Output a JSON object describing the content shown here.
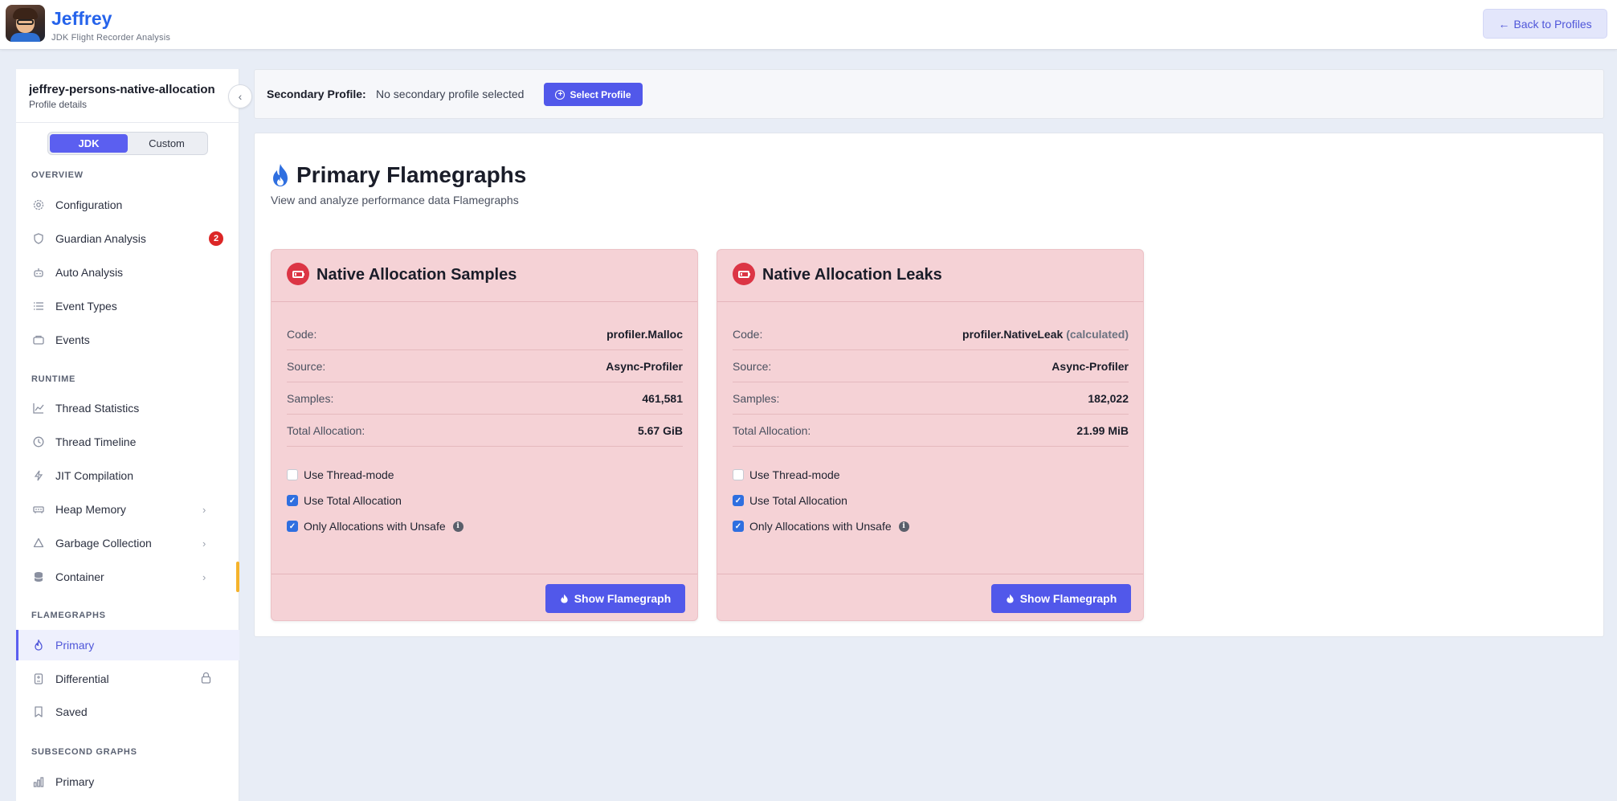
{
  "header": {
    "app_title": "Jeffrey",
    "app_subtitle": "JDK Flight Recorder Analysis",
    "back_label": "Back to Profiles",
    "back_arrow": "←"
  },
  "sidebar": {
    "profile_name": "jeffrey-persons-native-allocation",
    "profile_sub": "Profile details",
    "collapse_glyph": "‹",
    "mode_tabs": [
      "JDK",
      "Custom"
    ],
    "active_mode": "JDK",
    "sections": [
      {
        "title": "OVERVIEW",
        "items": [
          {
            "label": "Configuration",
            "icon": "gear-icon"
          },
          {
            "label": "Guardian Analysis",
            "icon": "shield-icon",
            "badge": "2"
          },
          {
            "label": "Auto Analysis",
            "icon": "robot-icon"
          },
          {
            "label": "Event Types",
            "icon": "list-icon"
          },
          {
            "label": "Events",
            "icon": "folder-icon"
          }
        ]
      },
      {
        "title": "RUNTIME",
        "items": [
          {
            "label": "Thread Statistics",
            "icon": "chart-line-icon"
          },
          {
            "label": "Thread Timeline",
            "icon": "clock-icon"
          },
          {
            "label": "JIT Compilation",
            "icon": "lightning-icon"
          },
          {
            "label": "Heap Memory",
            "icon": "memory-icon",
            "expandable": true
          },
          {
            "label": "Garbage Collection",
            "icon": "recycle-icon",
            "expandable": true
          },
          {
            "label": "Container",
            "icon": "database-icon",
            "expandable": true
          }
        ]
      },
      {
        "title": "FLAMEGRAPHS",
        "items": [
          {
            "label": "Primary",
            "icon": "fire-icon",
            "active": true
          },
          {
            "label": "Differential",
            "icon": "file-diff-icon",
            "locked": true
          },
          {
            "label": "Saved",
            "icon": "bookmark-icon"
          }
        ]
      },
      {
        "title": "SUBSECOND GRAPHS",
        "items": [
          {
            "label": "Primary",
            "icon": "bar-chart-icon"
          }
        ]
      }
    ]
  },
  "secondary": {
    "label": "Secondary Profile:",
    "value": "No secondary profile selected",
    "button_label": "Select Profile"
  },
  "main": {
    "title": "Primary Flamegraphs",
    "subtitle": "View and analyze performance data Flamegraphs",
    "cards": [
      {
        "title": "Native Allocation Samples",
        "rows": [
          {
            "key": "Code:",
            "value": "profiler.Malloc",
            "note": ""
          },
          {
            "key": "Source:",
            "value": "Async-Profiler",
            "note": ""
          },
          {
            "key": "Samples:",
            "value": "461,581",
            "note": ""
          },
          {
            "key": "Total Allocation:",
            "value": "5.67 GiB",
            "note": ""
          }
        ],
        "options": [
          {
            "label": "Use Thread-mode",
            "checked": false
          },
          {
            "label": "Use Total Allocation",
            "checked": true
          },
          {
            "label": "Only Allocations with Unsafe",
            "checked": true,
            "info": "i"
          }
        ],
        "button_label": "Show Flamegraph"
      },
      {
        "title": "Native Allocation Leaks",
        "rows": [
          {
            "key": "Code:",
            "value": "profiler.NativeLeak",
            "note": "(calculated)"
          },
          {
            "key": "Source:",
            "value": "Async-Profiler",
            "note": ""
          },
          {
            "key": "Samples:",
            "value": "182,022",
            "note": ""
          },
          {
            "key": "Total Allocation:",
            "value": "21.99 MiB",
            "note": ""
          }
        ],
        "options": [
          {
            "label": "Use Thread-mode",
            "checked": false
          },
          {
            "label": "Use Total Allocation",
            "checked": true
          },
          {
            "label": "Only Allocations with Unsafe",
            "checked": true,
            "info": "i"
          }
        ],
        "button_label": "Show Flamegraph"
      }
    ]
  },
  "colors": {
    "accent": "#5158ea",
    "brand": "#2563eb",
    "card_bg": "#f5d2d6",
    "danger": "#dc3545",
    "scroll_indicator": "#f5b32b"
  }
}
